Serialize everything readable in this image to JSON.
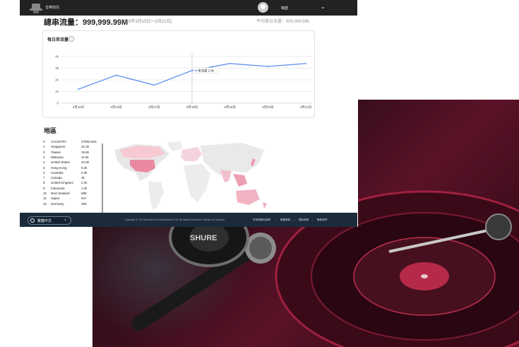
{
  "header": {
    "brand": "音樂撥信",
    "username": "梅望"
  },
  "summary": {
    "total_streams": "總串流量：999,999.99M",
    "date_range": "(2019年3月15日～3月21日)",
    "daily_average": "平均單日流量：999,999.99k"
  },
  "daily_card": {
    "title": "每日串流量",
    "help_icon": "?"
  },
  "chart_data": {
    "type": "line",
    "categories": [
      "3月15日",
      "3月16日",
      "3月17日",
      "3月18日",
      "3月19日",
      "3月20日",
      "3月21日"
    ],
    "series": [
      {
        "values": [
          1.2,
          2.4,
          1.55,
          2.8,
          3.4,
          3.15,
          3.4
        ]
      }
    ],
    "y_ticks": [
      "0",
      "1k",
      "2k",
      "3k",
      "4k"
    ],
    "ylim": [
      0,
      4
    ],
    "grid": true,
    "tooltip": {
      "category": "3月18日",
      "label": "串流量",
      "value": "2.8k"
    },
    "line_color": "#5b8def"
  },
  "region": {
    "title": "地區",
    "headers": [
      "#",
      "COUNTRY",
      "STREAMS"
    ],
    "rows": [
      [
        "1",
        "Singapore",
        "31.2k"
      ],
      [
        "2",
        "Taiwan",
        "18.8k"
      ],
      [
        "3",
        "Malaysia",
        "11.5k"
      ],
      [
        "4",
        "United States",
        "10.8k"
      ],
      [
        "5",
        "Hong Kong",
        "6.4k"
      ],
      [
        "6",
        "Australia",
        "4.3k"
      ],
      [
        "7",
        "Canada",
        "3k"
      ],
      [
        "8",
        "United Kingdom",
        "2.2k"
      ],
      [
        "9",
        "Indonesia",
        "1.4k"
      ],
      [
        "10",
        "New Zealand",
        "688"
      ],
      [
        "11",
        "Japan",
        "647"
      ],
      [
        "12",
        "Germany",
        "499"
      ]
    ]
  },
  "footer": {
    "language": "繁體中文",
    "copyright": "Copyright © JSJ International Entertainment Ltd. All Rights Reserved. Design by Segunto.",
    "links": [
      "資深和解析說明",
      "服務條款",
      "隱私政策",
      "聯絡我們"
    ]
  }
}
